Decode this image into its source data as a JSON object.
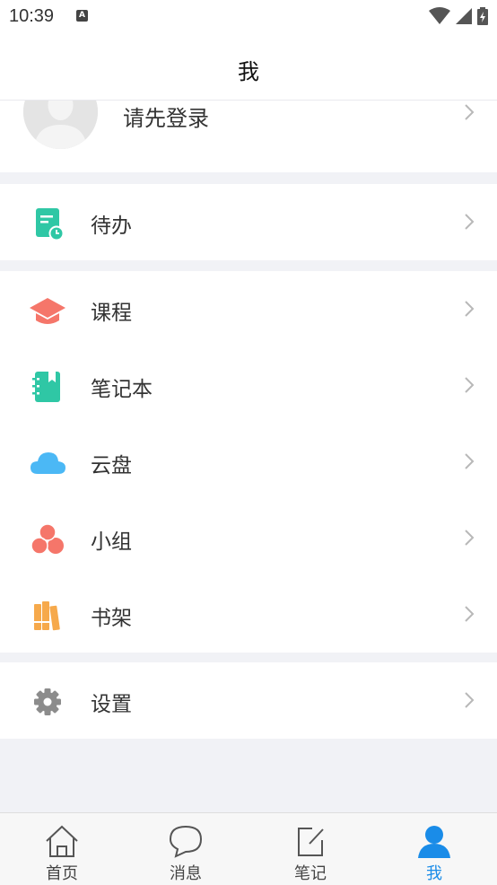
{
  "status_bar": {
    "time": "10:39",
    "notif_letter": "A"
  },
  "header": {
    "title": "我"
  },
  "profile": {
    "login_prompt": "请先登录"
  },
  "menu": {
    "todo": "待办",
    "courses": "课程",
    "notebook": "笔记本",
    "cloud": "云盘",
    "groups": "小组",
    "bookshelf": "书架",
    "settings": "设置"
  },
  "bottom_nav": {
    "items": [
      {
        "label": "首页",
        "icon": "home-icon"
      },
      {
        "label": "消息",
        "icon": "chat-bubble-icon"
      },
      {
        "label": "笔记",
        "icon": "edit-note-icon"
      },
      {
        "label": "我",
        "icon": "person-icon",
        "active": true
      }
    ]
  },
  "colors": {
    "active_tab": "#1a8ce8",
    "todo_icon": "#2fc7a5",
    "course_icon": "#f5766a",
    "notebook_icon": "#2fc7a5",
    "cloud_icon": "#4bb8f5",
    "group_icon": "#f5766a",
    "bookshelf_icon": "#f6a94b",
    "settings_icon": "#8c8c8c"
  }
}
